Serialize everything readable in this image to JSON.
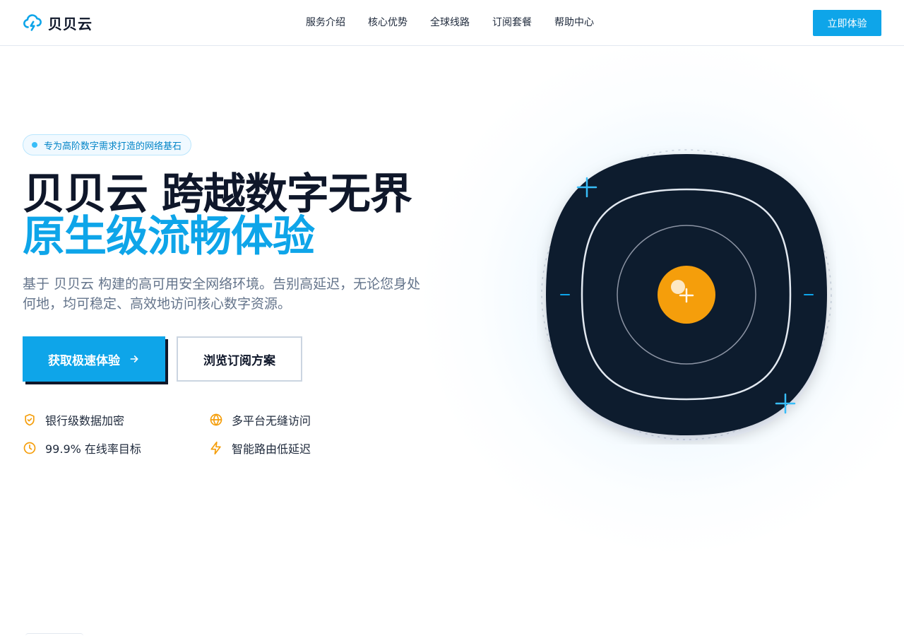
{
  "nav": {
    "brand": "贝贝云",
    "links": [
      "服务介绍",
      "核心优势",
      "全球线路",
      "订阅套餐",
      "帮助中心"
    ],
    "cta": "立即体验"
  },
  "hero": {
    "badge": "专为高阶数字需求打造的网络基石",
    "title_line1": "贝贝云 跨越数字无界",
    "title_line2": "原生级流畅体验",
    "subtitle": "基于 贝贝云 构建的高可用安全网络环境。告别高延迟，无论您身处何地，均可稳定、高效地访问核心数字资源。",
    "primary_button": "获取极速体验",
    "secondary_button": "浏览订阅方案",
    "features": [
      "银行级数据加密",
      "多平台无缝访问",
      "99.9% 在线率目标",
      "智能路由低延迟"
    ]
  },
  "colors": {
    "brand": "#0ea5e9",
    "dark": "#0f172a",
    "accent": "#f59e0b",
    "muted": "#64748b"
  },
  "icons": {
    "logo": "cloud-lightning-icon",
    "arrow": "arrow-right-icon",
    "features": [
      "shield-check-icon",
      "globe-icon",
      "clock-icon",
      "zap-icon"
    ]
  }
}
